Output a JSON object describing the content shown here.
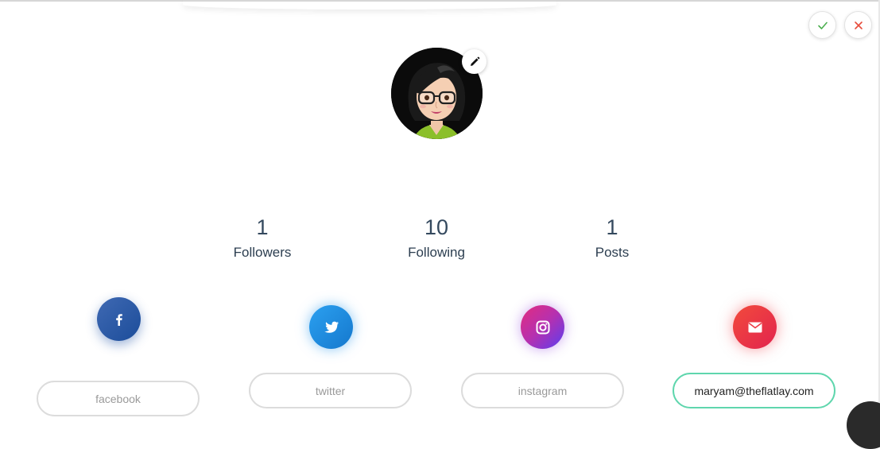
{
  "stats": {
    "followers": {
      "value": "1",
      "label": "Followers"
    },
    "following": {
      "value": "10",
      "label": "Following"
    },
    "posts": {
      "value": "1",
      "label": "Posts"
    }
  },
  "social_fields": {
    "facebook": {
      "placeholder": "facebook",
      "value": ""
    },
    "twitter": {
      "placeholder": "twitter",
      "value": ""
    },
    "instagram": {
      "placeholder": "instagram",
      "value": ""
    },
    "email": {
      "placeholder": "",
      "value": "maryam@theflatlay.com"
    }
  },
  "icons": {
    "confirm": "check-icon",
    "cancel": "close-icon",
    "edit": "pencil-icon",
    "facebook": "facebook-icon",
    "twitter": "twitter-icon",
    "instagram": "instagram-icon",
    "email": "mail-icon"
  },
  "colors": {
    "confirm": "#4caf50",
    "cancel": "#e74c3c",
    "active_border": "#5fd6ad",
    "facebook": "#2a5ca8",
    "twitter": "#1d8fe0",
    "instagram": "#c13584",
    "email": "#ee3a45"
  }
}
